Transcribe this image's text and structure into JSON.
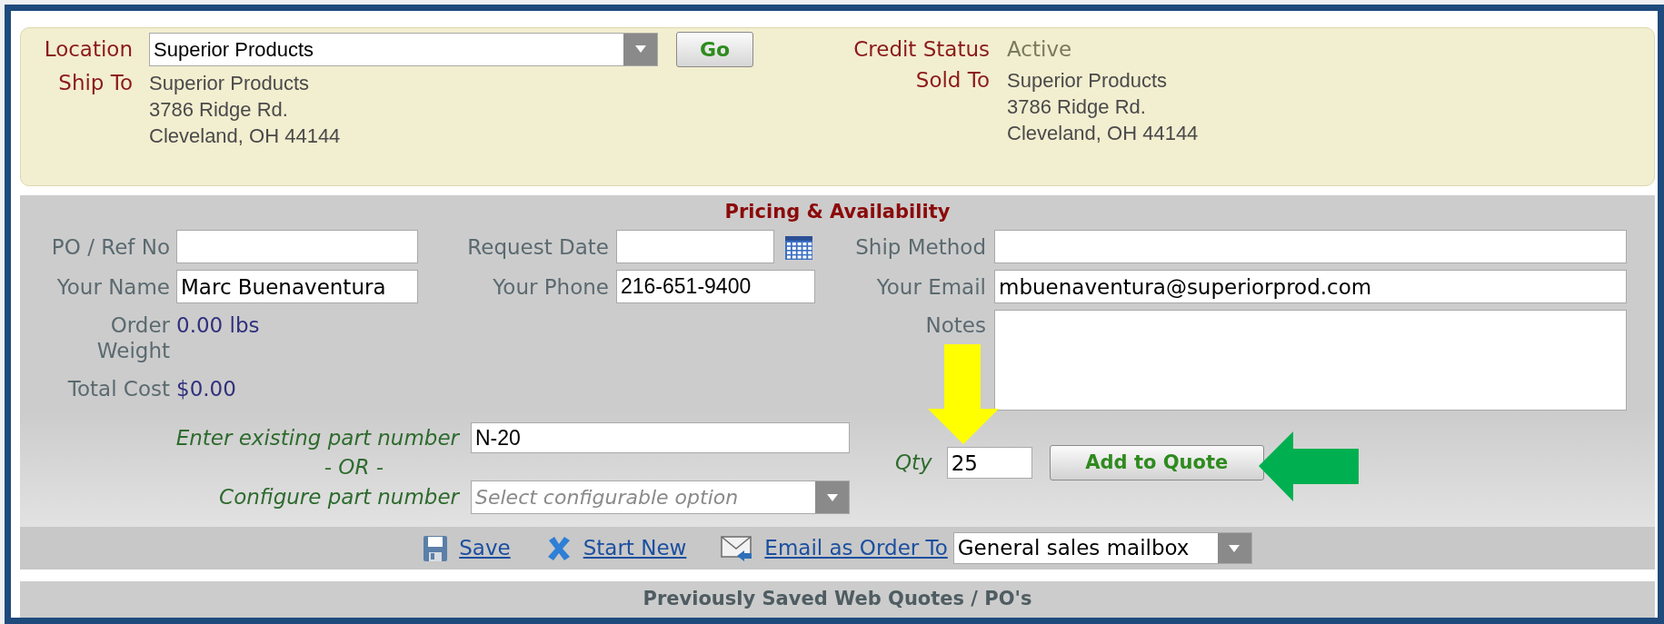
{
  "location": {
    "label": "Location",
    "value": "Superior Products"
  },
  "go_button": {
    "label": "Go"
  },
  "ship_to": {
    "label": "Ship To",
    "lines": [
      "Superior Products",
      "3786 Ridge Rd.",
      "Cleveland, OH 44144"
    ]
  },
  "credit_status": {
    "label": "Credit Status",
    "value": "Active"
  },
  "sold_to": {
    "label": "Sold To",
    "lines": [
      "Superior Products",
      "3786 Ridge Rd.",
      "Cleveland, OH 44144"
    ]
  },
  "pricing": {
    "title": "Pricing & Availability",
    "po_ref": {
      "label": "PO / Ref No"
    },
    "request_date": {
      "label": "Request Date"
    },
    "ship_method": {
      "label": "Ship Method"
    },
    "your_name": {
      "label": "Your Name",
      "value": "Marc Buenaventura"
    },
    "your_phone": {
      "label": "Your Phone",
      "value": "216-651-9400"
    },
    "your_email": {
      "label": "Your Email",
      "value": "mbuenaventura@superiorprod.com"
    },
    "order_weight": {
      "label": "Order Weight",
      "value": "0.00 lbs"
    },
    "total_cost": {
      "label": "Total Cost",
      "value": "$0.00"
    },
    "notes": {
      "label": "Notes"
    },
    "part_number": {
      "label": "Enter existing part number",
      "value": "N-20"
    },
    "separator": "- OR -",
    "configure": {
      "label": "Configure part number",
      "placeholder": "Select configurable option"
    },
    "qty": {
      "label": "Qty",
      "value": "25"
    },
    "add_button": {
      "label": "Add to Quote"
    }
  },
  "actions": [
    {
      "kind": "save",
      "label": "Save"
    },
    {
      "kind": "new",
      "label": "Start New"
    },
    {
      "kind": "email",
      "label": "Email as Order To"
    }
  ],
  "email_target": {
    "value": "General sales mailbox"
  },
  "saved_quotes": {
    "title": "Previously Saved Web Quotes / PO's"
  }
}
